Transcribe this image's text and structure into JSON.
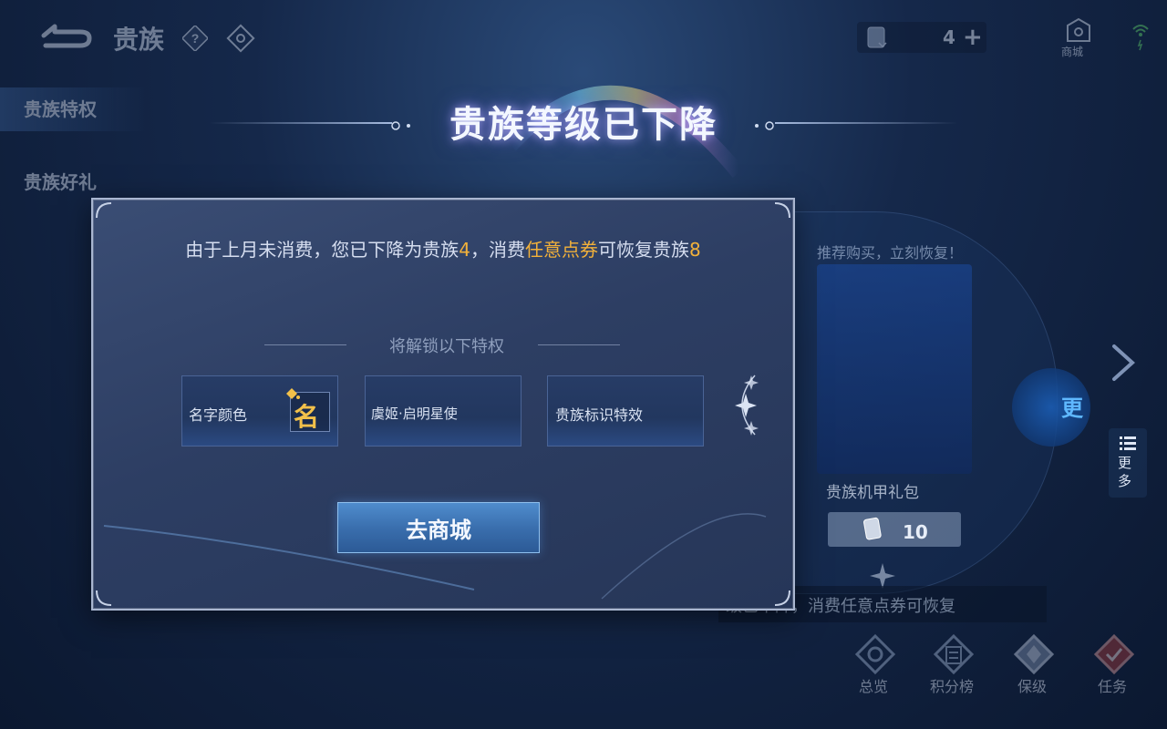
{
  "topbar": {
    "title": "贵族",
    "currency_value": "4",
    "shop_label": "商城"
  },
  "sidebar": {
    "items": [
      {
        "label": "贵族特权"
      },
      {
        "label": "贵族好礼"
      }
    ]
  },
  "background_panel": {
    "recommend_text": "推荐购买，立刻恢复！",
    "card_label": "贵族机甲礼包",
    "price_value": "10",
    "more_circle_text": "更",
    "more_button_text": "更多",
    "banner_text": "级已下降，消费任意点券可恢复"
  },
  "bottom_nav": {
    "items": [
      {
        "label": "总览",
        "icon": "overview-icon"
      },
      {
        "label": "积分榜",
        "icon": "leaderboard-icon"
      },
      {
        "label": "保级",
        "icon": "retain-level-icon"
      },
      {
        "label": "任务",
        "icon": "task-icon"
      }
    ]
  },
  "dialog": {
    "headline": "贵族等级已下降",
    "message_part1": "由于上月未消费，您已下降为贵族",
    "current_level": "4",
    "message_part2": "，消费",
    "highlight_term": "任意点券",
    "message_part3": "可恢复贵族",
    "target_level": "8",
    "unlock_heading": "将解锁以下特权",
    "privileges": [
      {
        "label": "名字颜色",
        "icon_glyph": "名"
      },
      {
        "label": "虞姬·启明星使"
      },
      {
        "label": "贵族标识特效"
      }
    ],
    "go_button_label": "去商城"
  },
  "colors": {
    "highlight": "#f2b13a",
    "button_blue": "#3a6fae",
    "dialog_bg": "#2d3e63"
  }
}
